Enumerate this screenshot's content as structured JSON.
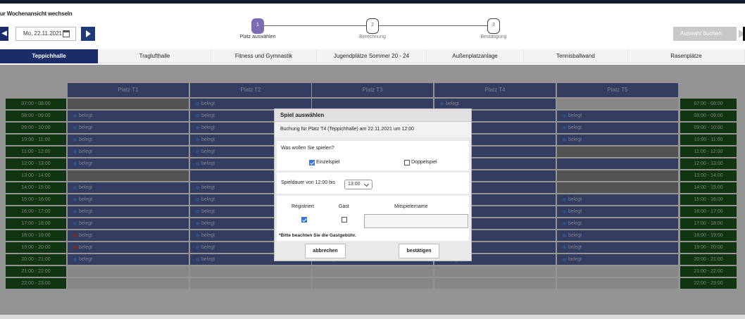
{
  "header": {
    "week_switch_label": "ur Wochenansicht wechseln",
    "date_value": "Mo, 22.11.2021",
    "book_button_label": "Auswahl buchen"
  },
  "steps": [
    {
      "number": "1",
      "label": "Platz auswählen",
      "active": true
    },
    {
      "number": "2",
      "label": "Berechnung",
      "active": false
    },
    {
      "number": "3",
      "label": "Bestätigung",
      "active": false
    }
  ],
  "tabs": [
    {
      "label": "Teppichhalle",
      "active": true
    },
    {
      "label": "Traglufthalle",
      "active": false
    },
    {
      "label": "Fitness und Gymnastik",
      "active": false
    },
    {
      "label": "Jugendplätze Sommer 20 - 24",
      "active": false
    },
    {
      "label": "Außenplatzanlage",
      "active": false
    },
    {
      "label": "Tennisballwand",
      "active": false
    },
    {
      "label": "Rasenplätze",
      "active": false
    }
  ],
  "courts": [
    "Platz T1",
    "Platz T2",
    "Platz T3",
    "Platz T4",
    "Platz T5"
  ],
  "booked_label": "belegt",
  "times": [
    "07:00 - 08:00",
    "08:00 - 09:00",
    "09:00 - 10:00",
    "10:00 - 11:00",
    "11:00 - 12:00",
    "12:00 - 13:00",
    "13:00 - 14:00",
    "14:00 - 15:00",
    "15:00 - 16:00",
    "16:00 - 17:00",
    "17:00 - 18:00",
    "18:00 - 19:00",
    "19:00 - 20:00",
    "20:00 - 21:00",
    "21:00 - 22:00",
    "22:00 - 23:00"
  ],
  "grid": [
    [
      "free",
      "blue",
      "",
      "blue",
      "empty"
    ],
    [
      "blue",
      "blue",
      "",
      "",
      "blue"
    ],
    [
      "blue",
      "blue",
      "",
      "",
      "blue"
    ],
    [
      "blue",
      "blue",
      "",
      "",
      "blue"
    ],
    [
      "blue",
      "blue",
      "",
      "",
      "free"
    ],
    [
      "blue",
      "blue",
      "",
      "",
      "booked"
    ],
    [
      "free",
      "",
      "",
      "",
      "free"
    ],
    [
      "blue",
      "blue",
      "",
      "",
      "free"
    ],
    [
      "blue",
      "blue",
      "",
      "",
      "blue"
    ],
    [
      "blue",
      "blue",
      "",
      "",
      "blue"
    ],
    [
      "blue",
      "blue",
      "",
      "",
      "blue"
    ],
    [
      "red",
      "blue",
      "",
      "",
      "blue"
    ],
    [
      "red",
      "blue",
      "",
      "",
      "blue"
    ],
    [
      "blue",
      "blue",
      "red",
      "blue",
      "blue"
    ],
    [
      "empty",
      "empty",
      "empty",
      "empty",
      "empty"
    ],
    [
      "empty",
      "empty",
      "empty",
      "empty",
      "empty"
    ]
  ],
  "modal": {
    "title": "Spiel auswählen",
    "subtitle": "Buchung für Platz T4 (Teppichhalle) am 22.11.2021 um 12:00",
    "question": "Was wollen Sie spielen?",
    "option_single": "Einzelspiel",
    "option_single_checked": true,
    "option_double": "Doppelspiel",
    "option_double_checked": false,
    "duration_label": "Spieldauer von 12:00 bis",
    "duration_value": "13:00",
    "col_registered": "Registriert",
    "col_guest": "Gast",
    "col_partner": "Mitspielername",
    "registered_checked": true,
    "guest_checked": false,
    "partner_value": "",
    "guest_fee_note": "*Bitte beachten Sie die Gastgebühr.",
    "cancel_label": "abbrechen",
    "confirm_label": "bestätigen"
  },
  "colors": {
    "navy": "#1b2c6b",
    "court_blue": "#5a68a8",
    "time_green": "#1e5a1e",
    "step_active": "#7b6bb0",
    "checkbox_blue": "#3b76d8"
  }
}
